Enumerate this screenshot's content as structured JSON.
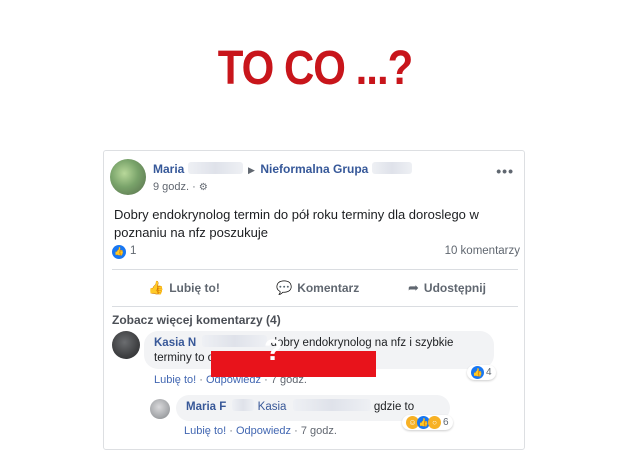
{
  "headline": "TO CO ...?",
  "post": {
    "author_first": "Maria",
    "group_name": "Nieformalna Grupa",
    "time": "9 godz. ·",
    "more_icon": "•••",
    "text": "Dobry endokrynolog termin do pół roku terminy dla doroslego w poznaniu na nfz poszukuje",
    "likes_count": "1",
    "comments_count": "10 komentarzy"
  },
  "actions": {
    "like": "Lubię to!",
    "comment": "Komentarz",
    "share": "Udostępnij"
  },
  "more_comments": "Zobacz więcej komentarzy (4)",
  "comments": [
    {
      "author": "Kasia N",
      "text_line1": "dobry endokrynolog na nfz i szybkie",
      "text_line2": "terminy to o",
      "like": "Lubię to!",
      "reply": "Odpowiedz",
      "time": "7 godz.",
      "reactions": "4"
    },
    {
      "author": "Maria F",
      "mention": "Kasia",
      "text": "gdzie to",
      "like": "Lubię to!",
      "reply": "Odpowiedz",
      "time": "7 godz.",
      "reactions": "6"
    }
  ],
  "colors": {
    "headline": "#c8151b",
    "link": "#365899",
    "redaction": "#e8131b",
    "like_blue": "#1877f2"
  }
}
